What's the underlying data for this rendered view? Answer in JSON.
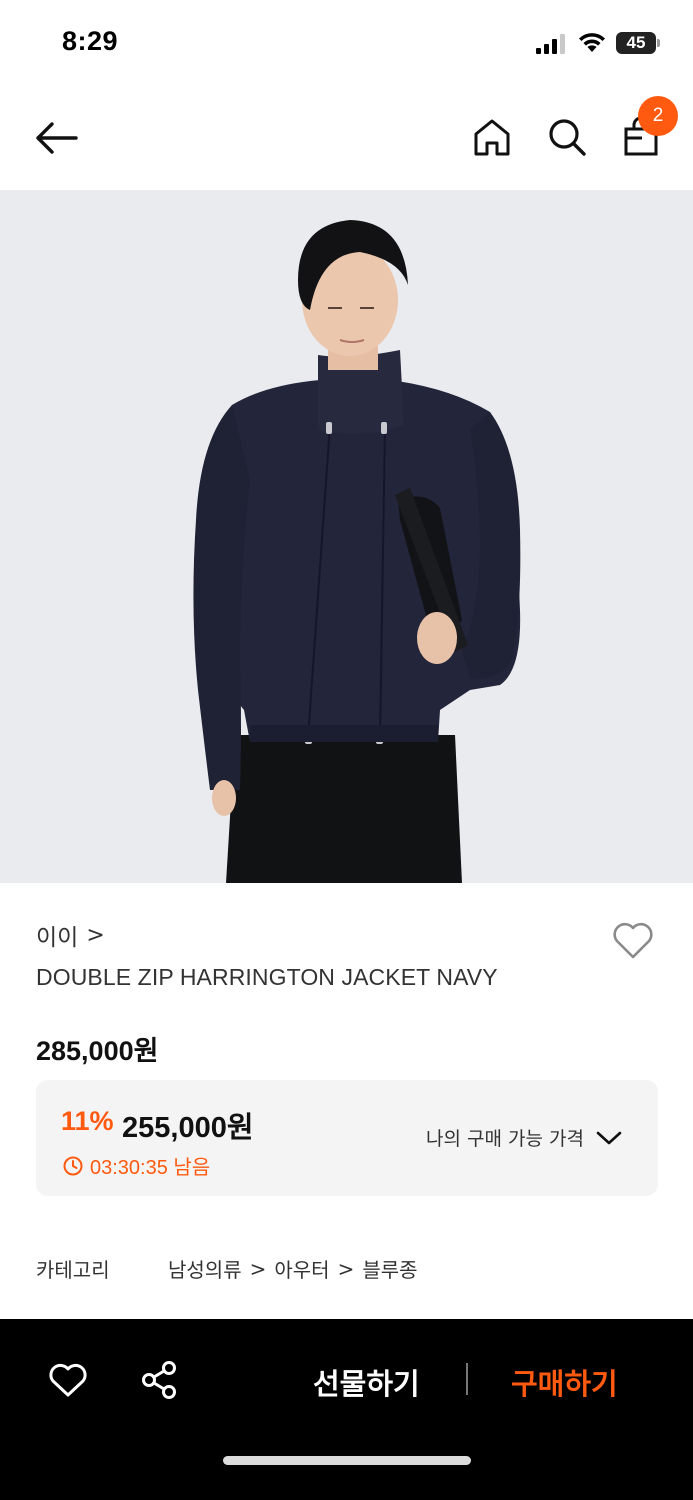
{
  "status_bar": {
    "time": "8:29",
    "battery": "45"
  },
  "header": {
    "back_icon": "arrow-left-icon",
    "home_icon": "home-icon",
    "search_icon": "search-icon",
    "cart_icon": "shopping-bag-icon",
    "cart_badge": "2"
  },
  "product": {
    "image_alt": "model wearing navy double zip jacket",
    "brand": "이이",
    "brand_chevron": ">",
    "title": "DOUBLE ZIP HARRINGTON JACKET NAVY",
    "original_price": "285,000원",
    "wishlist_icon": "heart-outline-icon"
  },
  "discount": {
    "rate": "11%",
    "sale_price": "255,000원",
    "timer": "03:30:35 남음",
    "my_price_label": "나의 구매 가능 가격"
  },
  "category": {
    "label": "카테고리",
    "path": [
      "남성의류",
      "아우터",
      "블루종"
    ],
    "separator": ">"
  },
  "bottom_bar": {
    "gift_label": "선물하기",
    "buy_label": "구매하기"
  },
  "colors": {
    "accent": "#ff5a0f",
    "bottom_bar_bg": "#000000",
    "discount_box_bg": "#f4f4f5",
    "jacket_navy": "#23253a"
  }
}
